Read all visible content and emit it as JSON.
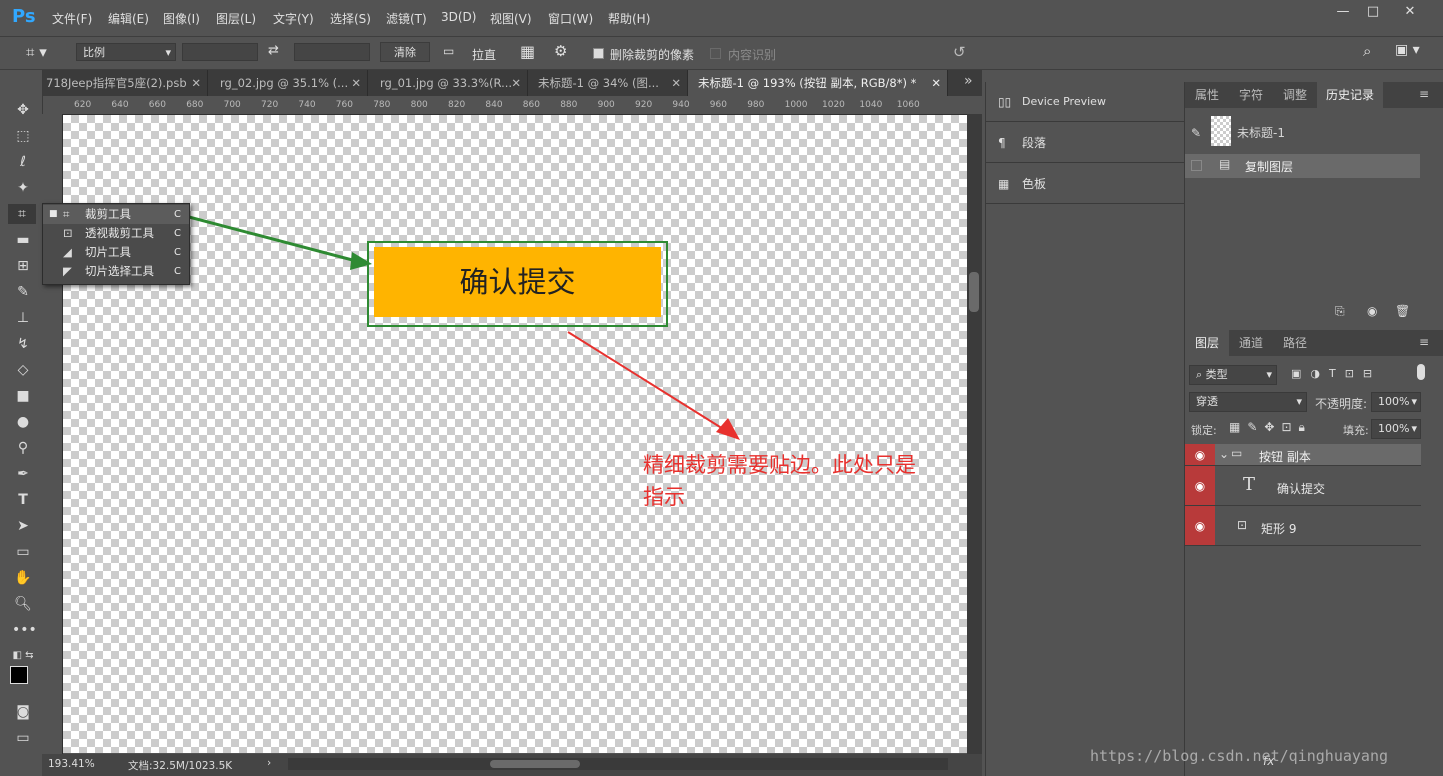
{
  "app": {
    "logo": "Ps"
  },
  "menu": [
    "文件(F)",
    "编辑(E)",
    "图像(I)",
    "图层(L)",
    "文字(Y)",
    "选择(S)",
    "滤镜(T)",
    "3D(D)",
    "视图(V)",
    "窗口(W)",
    "帮助(H)"
  ],
  "window_controls": {
    "minimize": "—",
    "restore": "□",
    "close": "✕"
  },
  "options": {
    "ratio": "比例",
    "clear": "清除",
    "straighten": "拉直",
    "delete_cropped_label": "删除裁剪的像素",
    "content_aware_label": "内容识别"
  },
  "tabs": [
    {
      "label": "718Jeep指挥官5座(2).psb",
      "close": "✕"
    },
    {
      "label": "rg_02.jpg @ 35.1% (...",
      "close": "✕"
    },
    {
      "label": "rg_01.jpg @ 33.3%(R...",
      "close": "✕"
    },
    {
      "label": "未标题-1 @ 34% (图...",
      "close": "✕"
    },
    {
      "label": "未标题-1 @ 193% (按钮 副本, RGB/8*) *",
      "close": "✕"
    }
  ],
  "tab_overflow": "»",
  "ruler_ticks": [
    "620",
    "640",
    "660",
    "680",
    "700",
    "720",
    "740",
    "760",
    "780",
    "800",
    "820",
    "840",
    "860",
    "880",
    "900",
    "920",
    "940",
    "960",
    "980",
    "1000",
    "1020",
    "1040",
    "1060"
  ],
  "canvas": {
    "button_text": "确认提交",
    "note": "精细裁剪需要贴边。此处只是指示"
  },
  "flyout": [
    {
      "label": "裁剪工具",
      "shortcut": "C",
      "icon": "crop-icon"
    },
    {
      "label": "透视裁剪工具",
      "shortcut": "C",
      "icon": "perspective-crop-icon"
    },
    {
      "label": "切片工具",
      "shortcut": "C",
      "icon": "slice-icon"
    },
    {
      "label": "切片选择工具",
      "shortcut": "C",
      "icon": "slice-select-icon"
    }
  ],
  "status": {
    "zoom": "193.41%",
    "doc": "文档:32.5M/1023.5K",
    "arrow": "›"
  },
  "mid_panels": [
    {
      "label": "Device Preview",
      "icon": "device-preview-icon"
    },
    {
      "label": "段落",
      "icon": "paragraph-icon"
    },
    {
      "label": "色板",
      "icon": "swatches-icon"
    }
  ],
  "top_panel": {
    "tabs": [
      "属性",
      "字符",
      "调整",
      "历史记录"
    ],
    "active_tab": "历史记录",
    "snapshot_label": "未标题-1",
    "history_items": [
      "复制图层"
    ]
  },
  "layers_panel": {
    "tabs": [
      "图层",
      "通道",
      "路径"
    ],
    "filter": "类型",
    "blend_mode": "穿透",
    "opacity_label": "不透明度:",
    "opacity": "100%",
    "lock_label": "锁定:",
    "fill_label": "填充:",
    "fill": "100%",
    "layers": [
      {
        "name": "按钮 副本",
        "type": "group"
      },
      {
        "name": "确认提交",
        "type": "text"
      },
      {
        "name": "矩形 9",
        "type": "shape"
      }
    ],
    "footer_fx": "fx"
  },
  "watermark": "https://blog.csdn.net/qinghuayang"
}
